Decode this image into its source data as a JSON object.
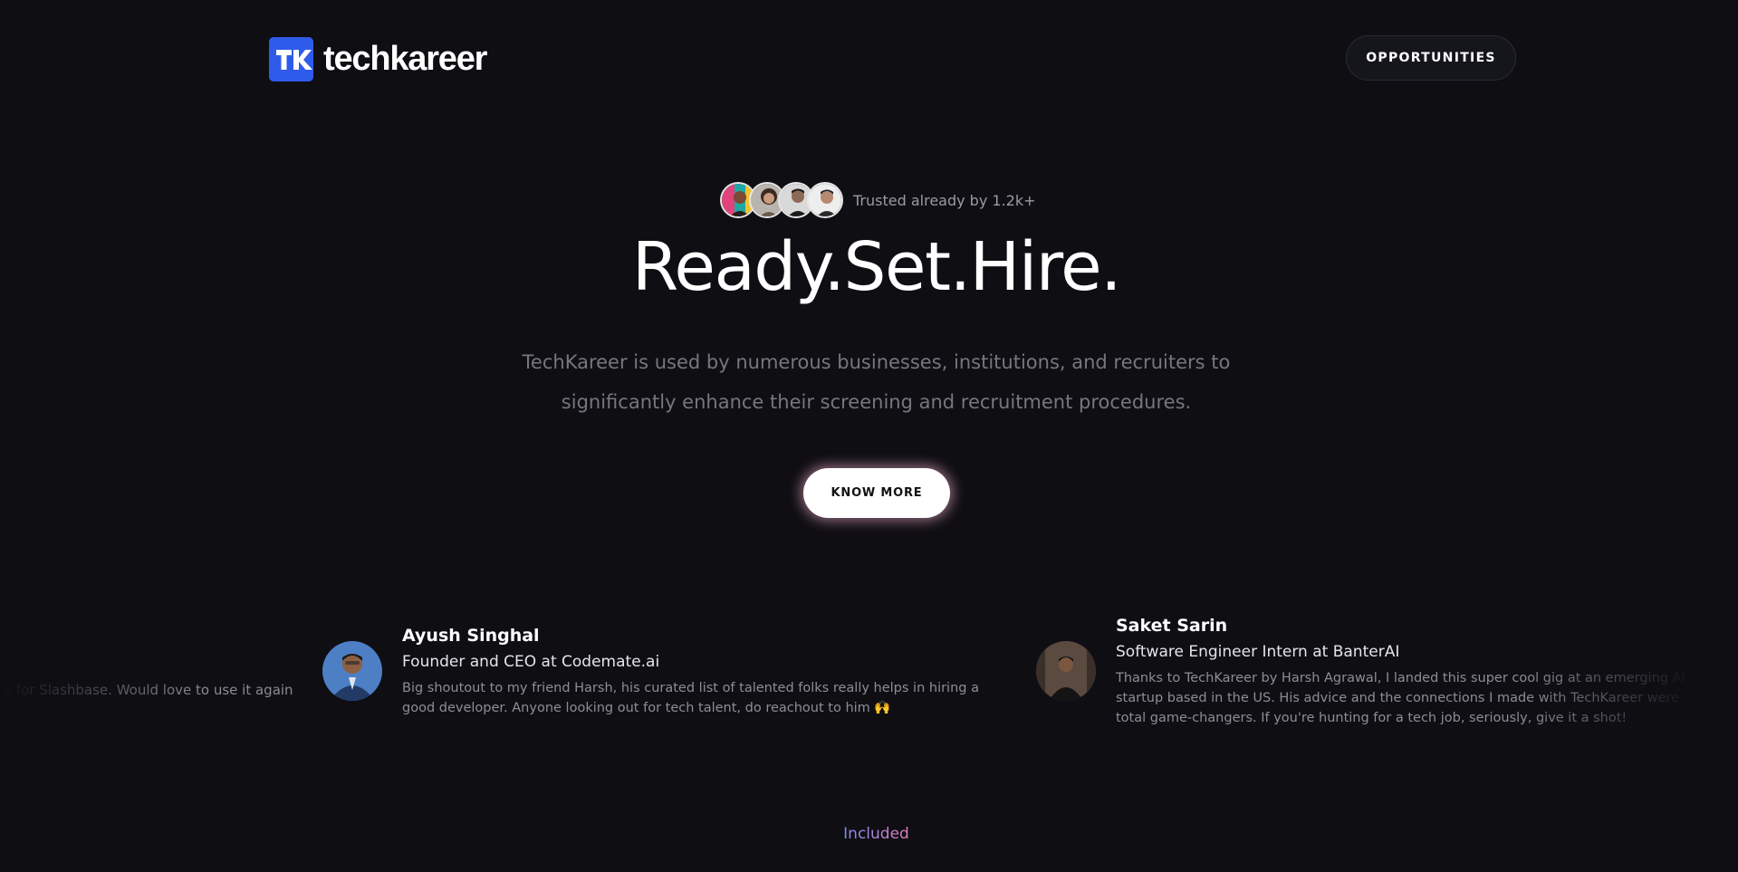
{
  "header": {
    "brand": "techkareer",
    "nav_button": "OPPORTUNITIES"
  },
  "hero": {
    "trust_text": "Trusted already by 1.2k+",
    "headline": "Ready.Set.Hire.",
    "subtitle": "TechKareer is used by numerous businesses, institutions, and recruiters to significantly enhance their screening and recruitment procedures.",
    "cta": "KNOW MORE"
  },
  "testimonials": [
    {
      "name": "",
      "role": "",
      "quote": "ly for Slashbase. Would love to use it again"
    },
    {
      "name": "Ayush Singhal",
      "role": "Founder and CEO at Codemate.ai",
      "quote": "Big shoutout to my friend Harsh, his curated list of talented folks really helps in hiring a good developer. Anyone looking out for tech talent, do reachout to him 🙌"
    },
    {
      "name": "Saket Sarin",
      "role": "Software Engineer Intern at BanterAI",
      "quote": "Thanks to TechKareer by Harsh Agrawal, I landed this super cool gig at an emerging AI startup based in the US. His advice and the connections I made with TechKareer were total game-changers. If you're hunting for a tech job, seriously, give it a shot!"
    }
  ],
  "features": {
    "eyebrow": "Included",
    "title": ""
  },
  "colors": {
    "background": "#0f0e13",
    "brand_blue": "#2f5bea",
    "muted_text": "#77767f"
  }
}
